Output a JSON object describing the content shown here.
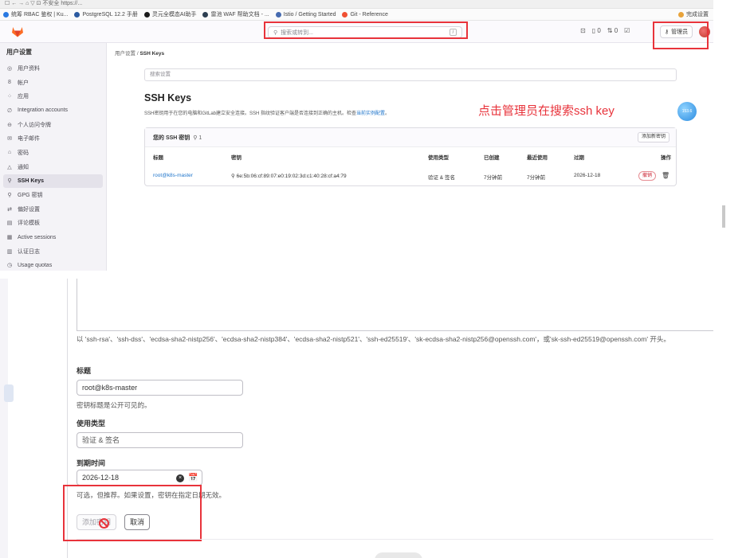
{
  "browser": {
    "strip_text": "☐  ←  →  ⌂  ▽  ⊡ 不安全  https://...",
    "bookmarks": [
      {
        "label": "统筹 RBAC 鉴权 | Ku...",
        "color": "#2a7ae2"
      },
      {
        "label": "PostgreSQL 12.2 手册",
        "color": "#2b5aa0"
      },
      {
        "label": "灵元全模态AI助手",
        "color": "#1a1a1a"
      },
      {
        "label": "雷池 WAF 帮助文档 - ...",
        "color": "#2c3e50"
      },
      {
        "label": "Istio / Getting Started",
        "color": "#466bb0"
      },
      {
        "label": "Git - Reference",
        "color": "#f05033"
      }
    ],
    "right_label": "完成设置"
  },
  "header": {
    "search_placeholder": "搜索或转到...",
    "search_kbd": "/",
    "icons": [
      "⊡",
      "▯ 0",
      "⇅ 0",
      "☑"
    ],
    "admin_label": "管理员",
    "admin_icon": "key-icon"
  },
  "sidebar": {
    "title": "用户设置",
    "items": [
      {
        "icon": "◎",
        "label": "用户资料",
        "active": false
      },
      {
        "icon": "8",
        "label": "帐户",
        "active": false
      },
      {
        "icon": "⁘",
        "label": "应用",
        "active": false
      },
      {
        "icon": "∅",
        "label": "Integration accounts",
        "active": false
      },
      {
        "icon": "⊖",
        "label": "个人访问令牌",
        "active": false
      },
      {
        "icon": "✉",
        "label": "电子邮件",
        "active": false
      },
      {
        "icon": "⌂",
        "label": "密码",
        "active": false
      },
      {
        "icon": "△",
        "label": "通知",
        "active": false
      },
      {
        "icon": "⚲",
        "label": "SSH Keys",
        "active": true
      },
      {
        "icon": "⚲",
        "label": "GPG 密钥",
        "active": false
      },
      {
        "icon": "⇄",
        "label": "偏好设置",
        "active": false
      },
      {
        "icon": "▤",
        "label": "评论模板",
        "active": false
      },
      {
        "icon": "▦",
        "label": "Active sessions",
        "active": false
      },
      {
        "icon": "▥",
        "label": "认证日志",
        "active": false
      },
      {
        "icon": "◷",
        "label": "Usage quotas",
        "active": false
      }
    ]
  },
  "main": {
    "breadcrumb_parent": "用户设置",
    "breadcrumb_sep": "/",
    "breadcrumb_current": "SSH Keys",
    "search_settings_placeholder": "搜索设置",
    "title": "SSH Keys",
    "description": "SSH密钥用于在您的电脑和GitLab建立安全连接。SSH 指纹验证客户端是否连接到正确的主机。检查",
    "description_link": "当前实例配置",
    "description_end": "。",
    "annotation": "点击管理员在搜索ssh key",
    "float_badge": "153.6"
  },
  "keys_table": {
    "heading": "您的 SSH 密钥",
    "count": "1",
    "add_button": "添加新密钥",
    "columns": [
      "标题",
      "密钥",
      "使用类型",
      "已创建",
      "最近使用",
      "过期",
      "操作"
    ],
    "rows": [
      {
        "title": "root@k8s-master",
        "fingerprint": "6e:5b:06:cf:89:07:e0:19:02:3d:c1:40:28:cf:a4:79",
        "usage": "验证 & 签名",
        "created": "7分钟前",
        "last_used": "7分钟前",
        "expires": "2026-12-18",
        "revoke": "撤销"
      }
    ]
  },
  "form": {
    "algo_text": "以 'ssh-rsa'、'ssh-dss'、'ecdsa-sha2-nistp256'、'ecdsa-sha2-nistp384'、'ecdsa-sha2-nistp521'、'ssh-ed25519'、'sk-ecdsa-sha2-nistp256@openssh.com'，或'sk-ssh-ed25519@openssh.com' 开头。",
    "title_label": "标题",
    "title_value": "root@k8s-master",
    "title_help": "密钥标题是公开可见的。",
    "usage_label": "使用类型",
    "usage_value": "验证 & 签名",
    "expiry_label": "到期时间",
    "expiry_value": "2026-12-18",
    "expiry_help": "可选，但推荐。如果设置，密钥在指定日期无效。",
    "add_button": "添加密钥",
    "cancel_button": "取消"
  },
  "colors": {
    "annotation_red": "#e8333b",
    "link_blue": "#1f75cb",
    "danger": "#c91c2b"
  }
}
